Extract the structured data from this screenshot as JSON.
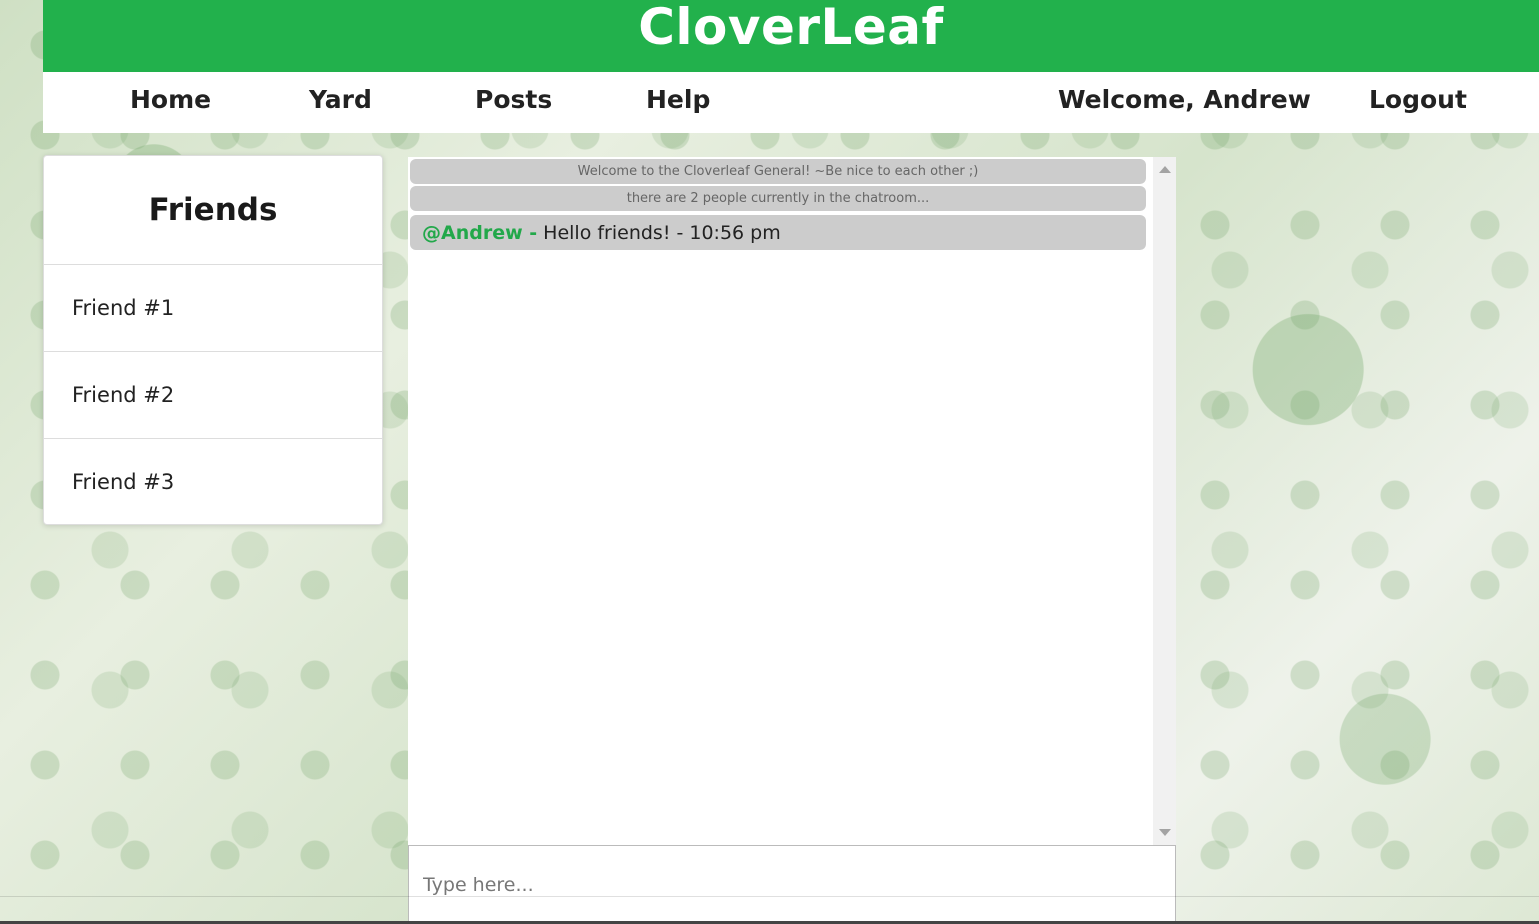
{
  "app": {
    "title": "CloverLeaf"
  },
  "nav": {
    "home": "Home",
    "yard": "Yard",
    "posts": "Posts",
    "help": "Help",
    "welcome": "Welcome, Andrew",
    "logout": "Logout"
  },
  "friends": {
    "title": "Friends",
    "items": [
      {
        "label": "Friend #1"
      },
      {
        "label": "Friend #2"
      },
      {
        "label": "Friend #3"
      }
    ]
  },
  "chat": {
    "system_messages": [
      "Welcome to the Cloverleaf General! ~Be nice to each other ;)",
      "there are 2 people currently in the chatroom..."
    ],
    "messages": [
      {
        "handle": "@Andrew -",
        "text": "Hello friends! - 10:56 pm"
      }
    ],
    "input_placeholder": "Type here..."
  },
  "colors": {
    "brand_green": "#22b14c",
    "handle_green": "#22a84a",
    "message_bg": "#cccccc"
  }
}
